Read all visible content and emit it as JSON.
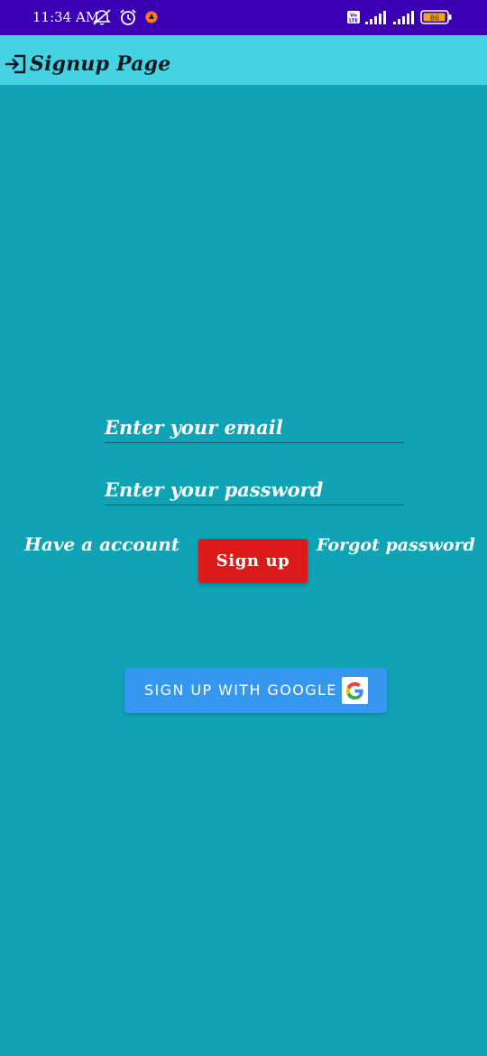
{
  "status_bar": {
    "time": "11:34 AM",
    "battery_level": "86",
    "icons": [
      "mute-icon",
      "alarm-icon",
      "notification-icon",
      "volte-icon",
      "signal-icon",
      "signal-icon",
      "battery-icon"
    ]
  },
  "app_bar": {
    "icon": "login-icon",
    "title": "Signup Page"
  },
  "form": {
    "email_placeholder": "Enter your email",
    "email_value": "",
    "password_placeholder": "Enter your password",
    "password_value": ""
  },
  "links": {
    "have_account": "Have a account",
    "forgot_password": "Forgot password"
  },
  "buttons": {
    "signup_label": "Sign up",
    "google_label": "SIGN UP WITH GOOGLE",
    "google_icon": "google-g-icon"
  },
  "colors": {
    "status_bar": "#3b00b4",
    "app_bar": "#45d3e4",
    "background": "#10a3b6",
    "signup_button": "#dc1a1a",
    "google_button": "#3597ee"
  }
}
